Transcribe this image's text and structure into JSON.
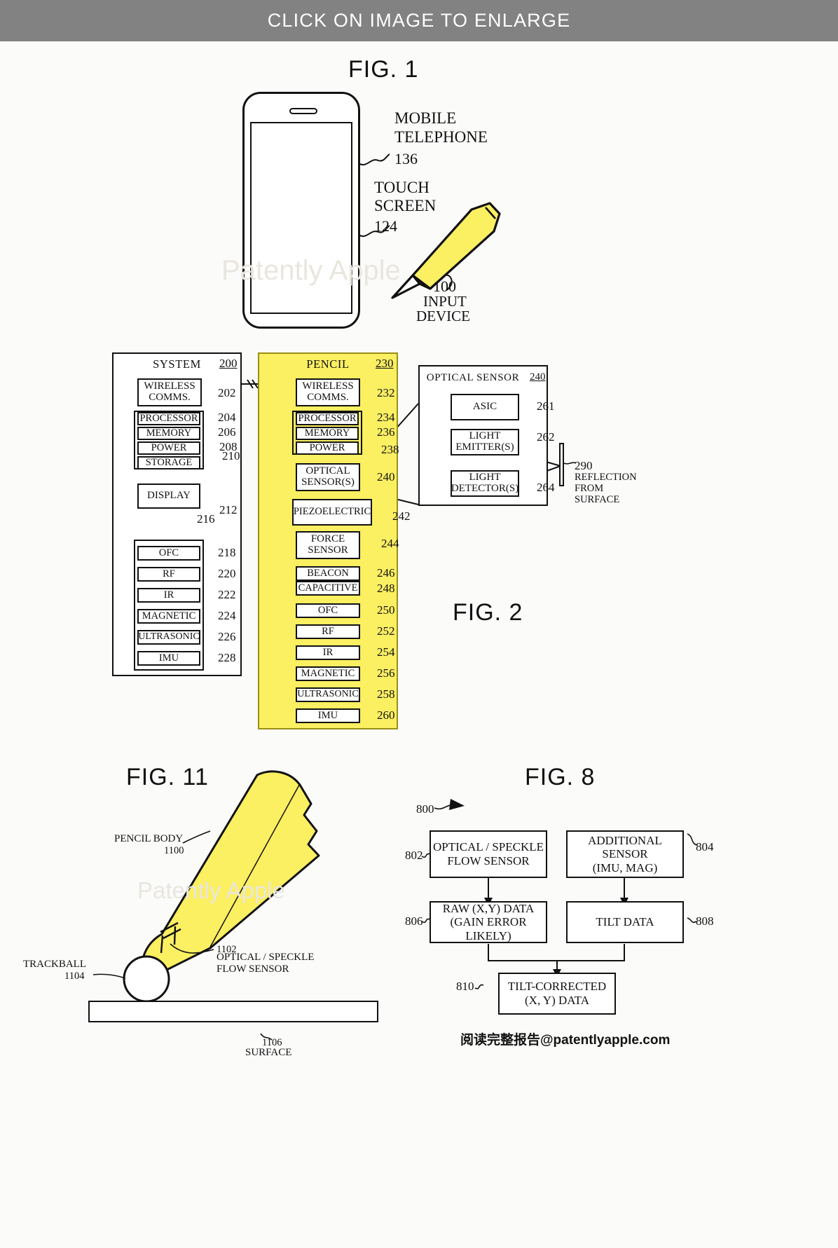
{
  "banner": {
    "text": "CLICK ON IMAGE TO ENLARGE"
  },
  "watermarks": {
    "fig1": "Patently Apple",
    "fig11": "Patently Apple"
  },
  "footer": {
    "credit": "阅读完整报告@patentlyapple.com"
  },
  "fig1": {
    "title": "FIG. 1",
    "labels": {
      "mobile_telephone": "MOBILE\nTELEPHONE",
      "mobile_telephone_line1": "MOBILE",
      "mobile_telephone_line2": "TELEPHONE",
      "mobile_telephone_ref": "136",
      "touch_screen_line1": "TOUCH",
      "touch_screen_line2": "SCREEN",
      "touch_screen_ref": "124",
      "input_device_ref": "100",
      "input_device_line1": "INPUT",
      "input_device_line2": "DEVICE"
    }
  },
  "fig2": {
    "title": "FIG. 2",
    "system": {
      "title": "SYSTEM",
      "ref": "200",
      "wireless": {
        "line1": "WIRELESS",
        "line2": "COMMS.",
        "ref": "202"
      },
      "core": [
        {
          "label": "PROCESSOR",
          "ref": "204"
        },
        {
          "label": "MEMORY",
          "ref": "206"
        },
        {
          "label": "POWER",
          "ref": "208"
        },
        {
          "label": "STORAGE",
          "ref": "210"
        }
      ],
      "display": {
        "label": "DISPLAY",
        "ref": "212"
      },
      "sensors_group_ref": "216",
      "sensors": [
        {
          "label": "OFC",
          "ref": "218"
        },
        {
          "label": "RF",
          "ref": "220"
        },
        {
          "label": "IR",
          "ref": "222"
        },
        {
          "label": "MAGNETIC",
          "ref": "224"
        },
        {
          "label": "ULTRASONIC",
          "ref": "226"
        },
        {
          "label": "IMU",
          "ref": "228"
        }
      ]
    },
    "pencil": {
      "title": "PENCIL",
      "ref": "230",
      "wireless": {
        "line1": "WIRELESS",
        "line2": "COMMS.",
        "ref": "232"
      },
      "core": [
        {
          "label": "PROCESSOR",
          "ref": "234"
        },
        {
          "label": "MEMORY",
          "ref": "236"
        },
        {
          "label": "POWER",
          "ref": "238"
        }
      ],
      "optical": {
        "line1": "OPTICAL",
        "line2": "SENSOR(S)",
        "ref": "240"
      },
      "piezo": {
        "label": "PIEZOELECTRIC",
        "ref": "242"
      },
      "force": {
        "line1": "FORCE",
        "line2": "SENSOR",
        "ref": "244"
      },
      "items": [
        {
          "label": "BEACON",
          "ref": "246"
        },
        {
          "label": "CAPACITIVE",
          "ref": "248"
        },
        {
          "label": "OFC",
          "ref": "250"
        },
        {
          "label": "RF",
          "ref": "252"
        },
        {
          "label": "IR",
          "ref": "254"
        },
        {
          "label": "MAGNETIC",
          "ref": "256"
        },
        {
          "label": "ULTRASONIC",
          "ref": "258"
        },
        {
          "label": "IMU",
          "ref": "260"
        }
      ]
    },
    "optical_sensor": {
      "title": "OPTICAL SENSOR",
      "ref": "240",
      "asic": {
        "label": "ASIC",
        "ref": "261"
      },
      "emitter": {
        "line1": "LIGHT",
        "line2": "EMITTER(S)",
        "ref": "262"
      },
      "detector": {
        "line1": "LIGHT",
        "line2": "DETECTOR(S)",
        "ref": "264"
      },
      "reflection": {
        "ref": "290",
        "line1": "REFLECTION",
        "line2": "FROM",
        "line3": "SURFACE"
      }
    }
  },
  "fig11": {
    "title": "FIG. 11",
    "pencil_body": {
      "line1": "PENCIL BODY",
      "ref": "1100"
    },
    "sensor": {
      "ref": "1102",
      "line1": "OPTICAL / SPECKLE",
      "line2": "FLOW SENSOR"
    },
    "trackball": {
      "line1": "TRACKBALL",
      "ref": "1104"
    },
    "surface": {
      "ref": "1106",
      "label": "SURFACE"
    }
  },
  "fig8": {
    "title": "FIG. 8",
    "flow_ref": "800",
    "nodes": [
      {
        "ref": "802",
        "line1": "OPTICAL / SPECKLE",
        "line2": "FLOW SENSOR"
      },
      {
        "ref": "804",
        "line1": "ADDITIONAL SENSOR",
        "line2": "(IMU, MAG)"
      },
      {
        "ref": "806",
        "line1": "RAW (X,Y) DATA",
        "line2": "(GAIN ERROR LIKELY)"
      },
      {
        "ref": "808",
        "line1": "TILT DATA",
        "line2": ""
      },
      {
        "ref": "810",
        "line1": "TILT-CORRECTED",
        "line2": "(X, Y) DATA"
      }
    ]
  },
  "colors": {
    "banner_bg": "#828282",
    "pencil_yellow": "#fbef62",
    "ink": "#111111",
    "page_bg": "#fbfbfa"
  }
}
